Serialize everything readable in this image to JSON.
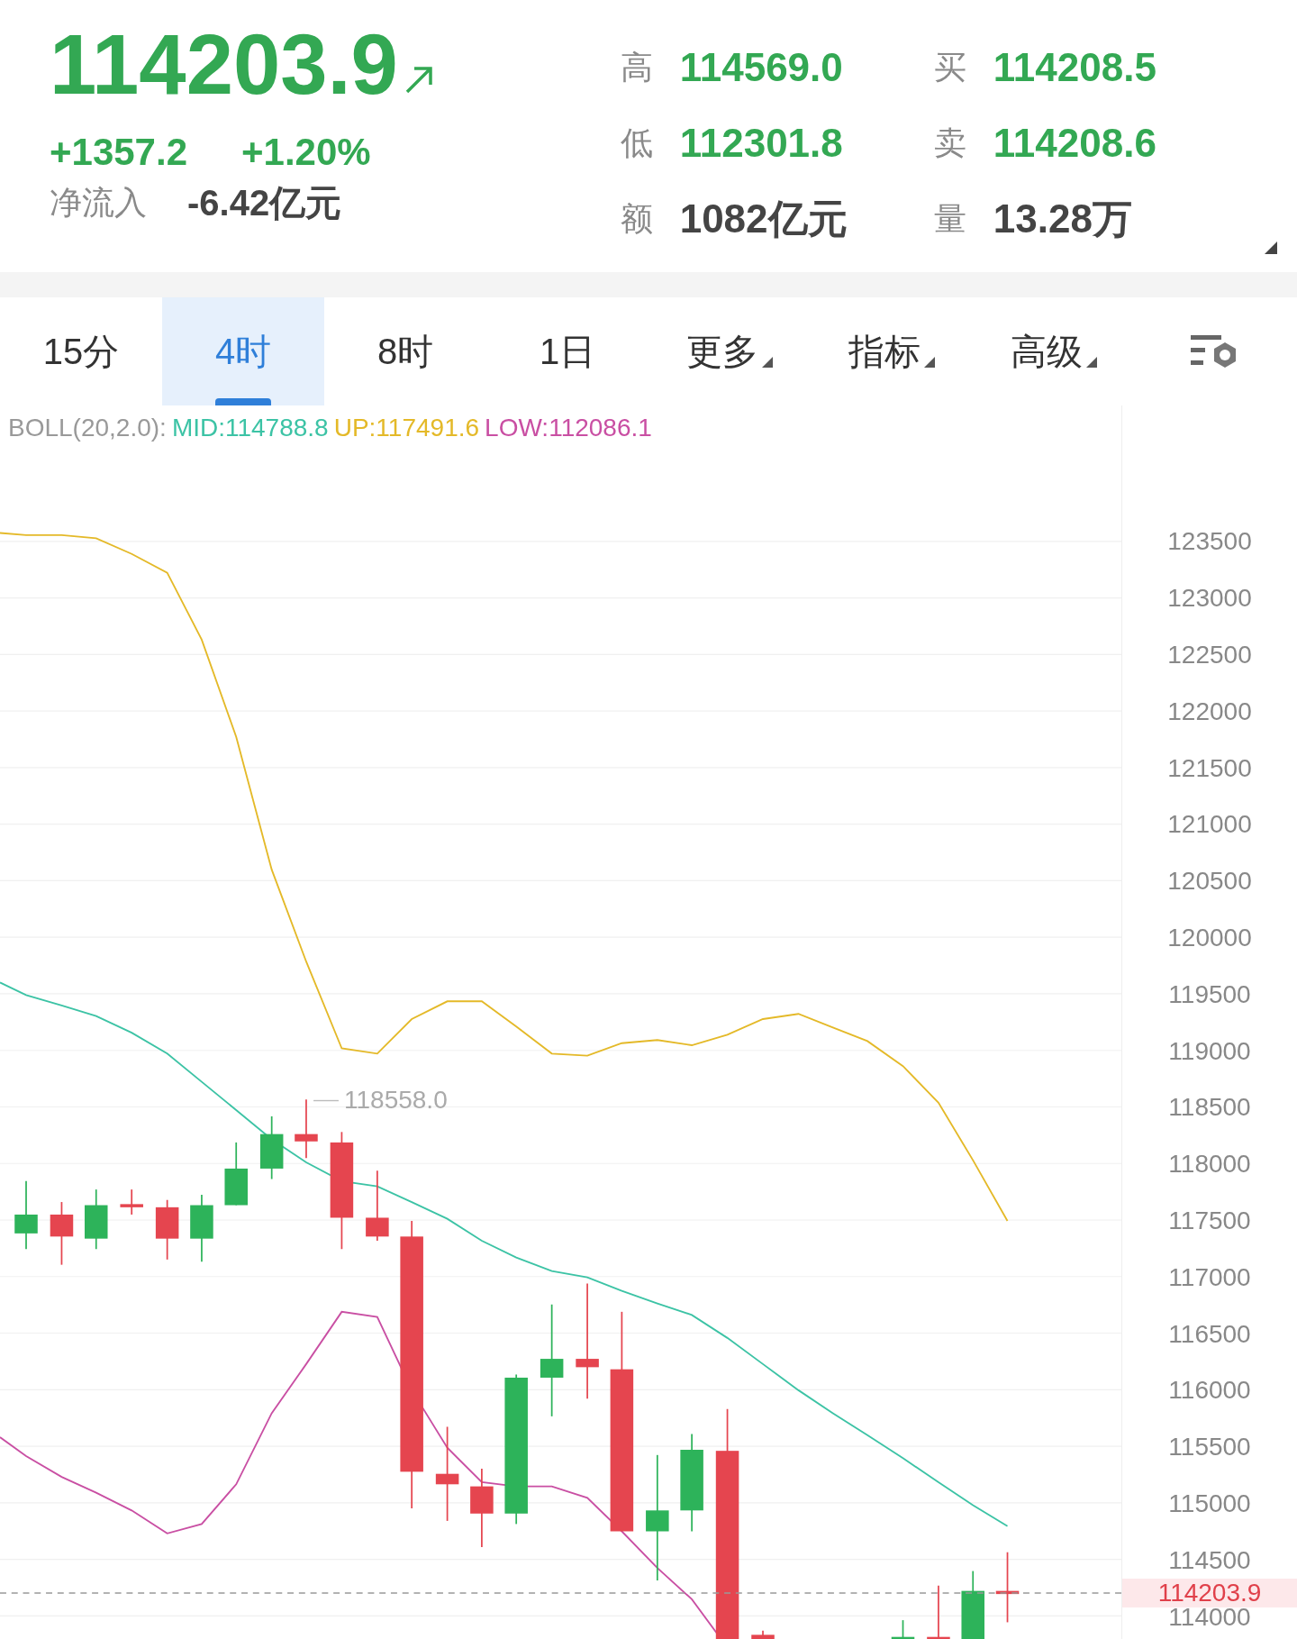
{
  "quote": {
    "price": "114203.9",
    "change": "+1357.2",
    "change_pct": "+1.20%",
    "net_inflow_label": "净流入",
    "net_inflow": "-6.42亿元"
  },
  "stats": [
    {
      "label": "高",
      "value": "114569.0",
      "kind": "price"
    },
    {
      "label": "买",
      "value": "114208.5",
      "kind": "price"
    },
    {
      "label": "低",
      "value": "112301.8",
      "kind": "price"
    },
    {
      "label": "卖",
      "value": "114208.6",
      "kind": "price"
    },
    {
      "label": "额",
      "value": "1082亿元",
      "kind": "amount"
    },
    {
      "label": "量",
      "value": "13.28万",
      "kind": "amount"
    }
  ],
  "tabs": [
    {
      "label": "15分",
      "selected": false,
      "dropdown": false
    },
    {
      "label": "4时",
      "selected": true,
      "dropdown": false
    },
    {
      "label": "8时",
      "selected": false,
      "dropdown": false
    },
    {
      "label": "1日",
      "selected": false,
      "dropdown": false
    },
    {
      "label": "更多",
      "selected": false,
      "dropdown": true
    },
    {
      "label": "指标",
      "selected": false,
      "dropdown": true
    },
    {
      "label": "高级",
      "selected": false,
      "dropdown": true
    }
  ],
  "indicator": {
    "name": "BOLL(20,2.0):",
    "mid": "MID:114788.8",
    "up": "UP:117491.6",
    "low": "LOW:112086.1"
  },
  "chart": {
    "y_axis_labels": [
      "123500",
      "123000",
      "122500",
      "122000",
      "121500",
      "121000",
      "120500",
      "120000",
      "119500",
      "119000",
      "118500",
      "118000",
      "117500",
      "117000",
      "116500",
      "116000",
      "115500",
      "115000",
      "114500",
      "114000"
    ],
    "high_marker": "118558.0",
    "last_price": "114203.9"
  }
}
